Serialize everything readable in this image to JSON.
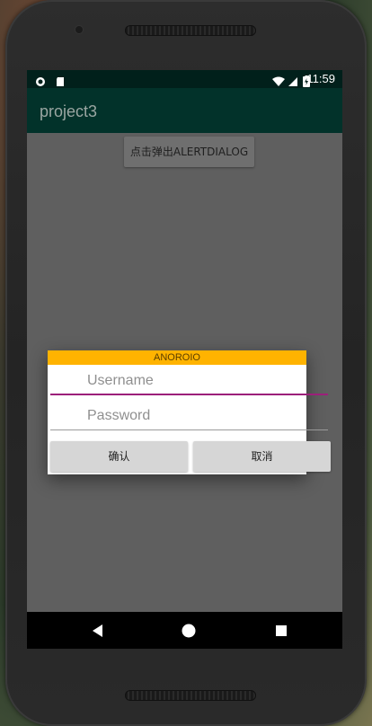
{
  "statusbar": {
    "time": "11:59",
    "icons": [
      "circle-notification-icon",
      "sd-card-icon",
      "wifi-icon",
      "cell-signal-icon",
      "battery-charging-icon"
    ]
  },
  "appbar": {
    "title": "project3"
  },
  "main": {
    "button_label": "点击弹出ALERTDIALOG"
  },
  "dialog": {
    "title": "ANOROIO",
    "username": {
      "value": "",
      "placeholder": "Username"
    },
    "password": {
      "value": "",
      "placeholder": "Password"
    },
    "confirm_label": "确认",
    "cancel_label": "取消"
  },
  "navbar": {
    "icons": [
      "back-icon",
      "home-icon",
      "recents-icon"
    ]
  },
  "colors": {
    "status_bar": "#01201b",
    "app_bar": "#02322a",
    "dim_background": "#5f5f5f",
    "dialog_title_bar": "#ffb300",
    "username_underline": "#9c1f7a",
    "password_underline": "#9a9a9a",
    "dialog_button": "#d6d6d6"
  }
}
